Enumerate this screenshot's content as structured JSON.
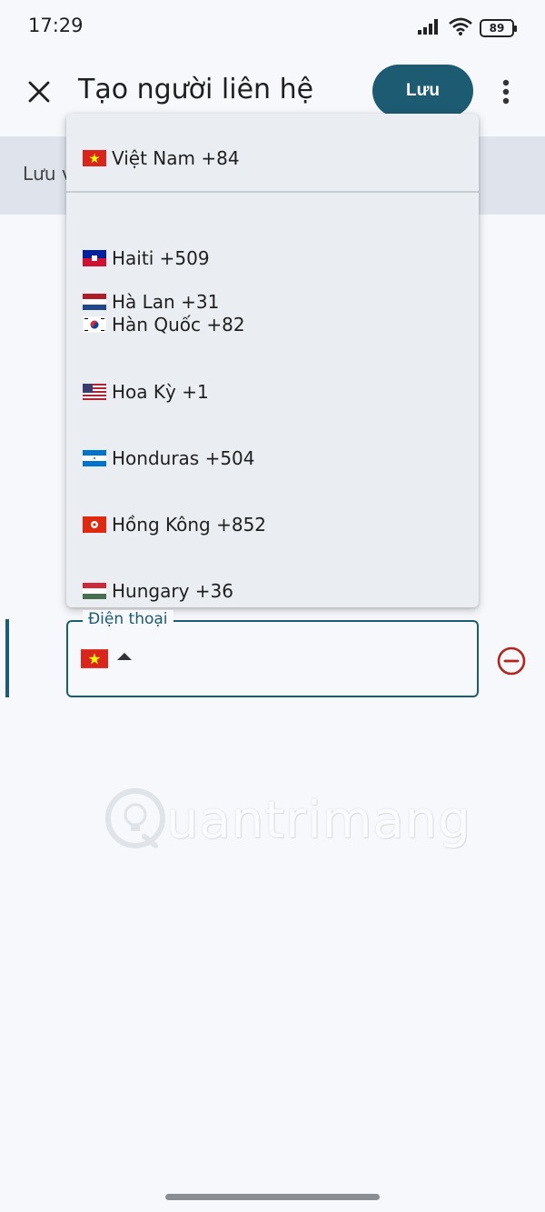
{
  "status_bar": {
    "time": "17:29",
    "battery": "89"
  },
  "app_bar": {
    "title": "Tạo người liên hệ",
    "save_label": "Lưu"
  },
  "banner": {
    "text": "Lưu v"
  },
  "dropdown": {
    "selected": {
      "label": "Việt Nam +84",
      "flag": "vn-flag-icon"
    },
    "items": [
      {
        "label": "Hà Lan +31",
        "flag": "nl-flag-icon"
      },
      {
        "label": "Haiti +509",
        "flag": "ht-flag-icon"
      },
      {
        "label": "Hàn Quốc +82",
        "flag": "kr-flag-icon"
      },
      {
        "label": "Hoa Kỳ +1",
        "flag": "us-flag-icon"
      },
      {
        "label": "Honduras +504",
        "flag": "hn-flag-icon"
      },
      {
        "label": "Hồng Kông +852",
        "flag": "hk-flag-icon"
      },
      {
        "label": "Hungary +36",
        "flag": "hu-flag-icon"
      }
    ]
  },
  "phone_field": {
    "label": "Điện thoại",
    "flag": "vn-flag-icon"
  },
  "watermark": {
    "text": "uantrimang"
  },
  "colors": {
    "accent": "#1d5b73",
    "remove": "#b3261e",
    "background": "#f6f8fc"
  }
}
